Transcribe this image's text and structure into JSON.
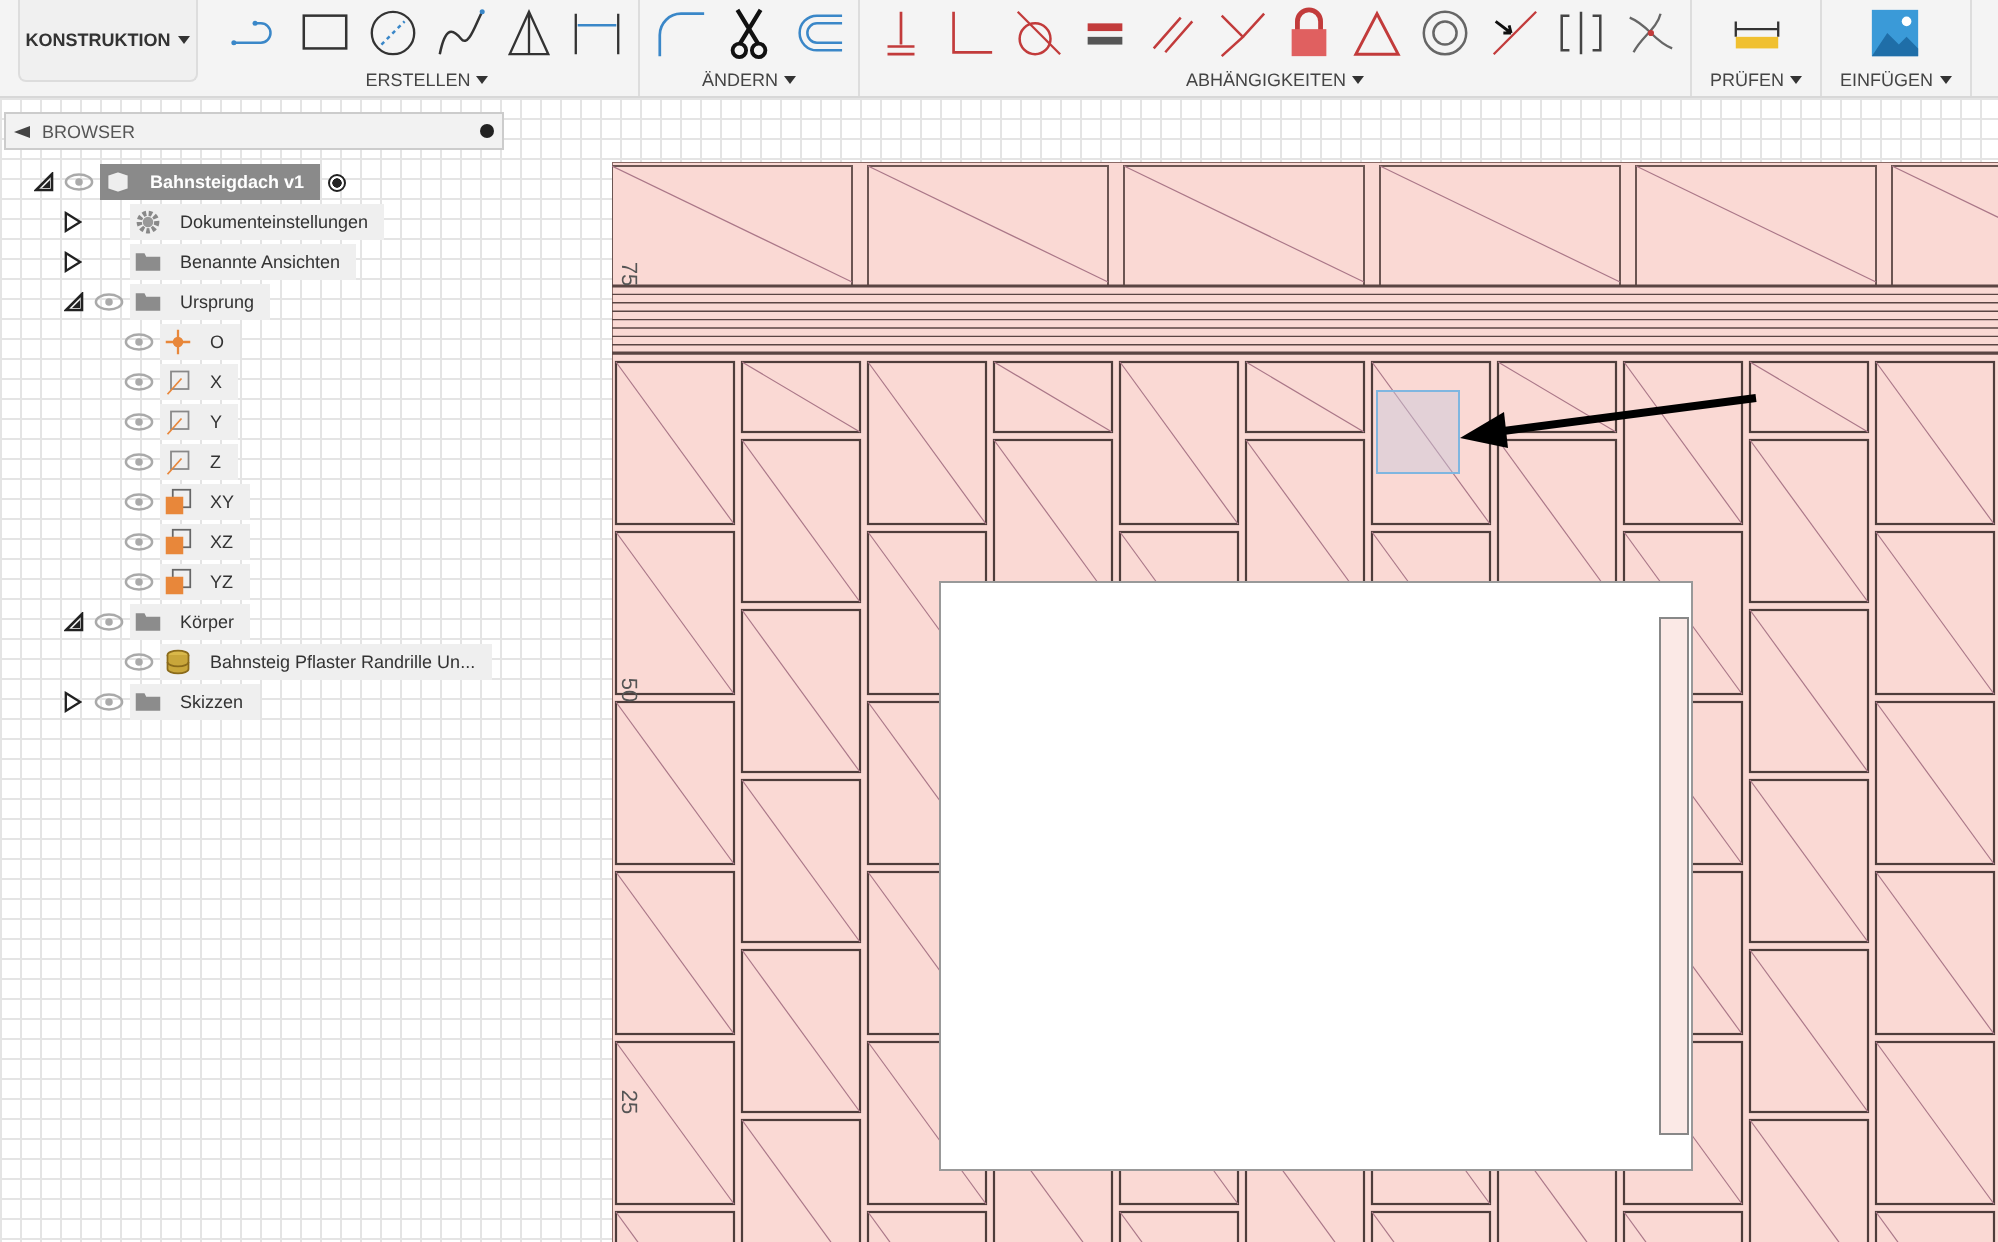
{
  "toolbar": {
    "workspace": "KONSTRUKTION",
    "groups": [
      {
        "label": "ERSTELLEN"
      },
      {
        "label": "ÄNDERN"
      },
      {
        "label": "ABHÄNGIGKEITEN"
      },
      {
        "label": "PRÜFEN"
      },
      {
        "label": "EINFÜGEN"
      }
    ]
  },
  "browser": {
    "title": "BROWSER",
    "items": [
      {
        "kind": "component",
        "label": "Bahnsteigdach v1",
        "eye": true,
        "expanded": true,
        "active": true,
        "selected": true,
        "children": [
          {
            "kind": "gear",
            "label": "Dokumenteinstellungen",
            "eye": false,
            "expanded": false,
            "selected": false
          },
          {
            "kind": "folder",
            "label": "Benannte Ansichten",
            "eye": false,
            "expanded": false,
            "selected": false
          },
          {
            "kind": "folder",
            "label": "Ursprung",
            "eye": true,
            "expanded": true,
            "selected": false,
            "children": [
              {
                "kind": "point",
                "label": "O",
                "eye": true,
                "selected": false
              },
              {
                "kind": "axis",
                "label": "X",
                "eye": true,
                "selected": false
              },
              {
                "kind": "axis",
                "label": "Y",
                "eye": true,
                "selected": false
              },
              {
                "kind": "axis",
                "label": "Z",
                "eye": true,
                "selected": false
              },
              {
                "kind": "plane",
                "label": "XY",
                "eye": true,
                "selected": false
              },
              {
                "kind": "plane",
                "label": "XZ",
                "eye": true,
                "selected": false
              },
              {
                "kind": "plane",
                "label": "YZ",
                "eye": true,
                "selected": false
              }
            ]
          },
          {
            "kind": "folder",
            "label": "Körper",
            "eye": true,
            "expanded": true,
            "selected": false,
            "children": [
              {
                "kind": "body",
                "label": "Bahnsteig Pflaster Randrille Un...",
                "eye": true,
                "selected": false
              }
            ]
          },
          {
            "kind": "folder",
            "label": "Skizzen",
            "eye": true,
            "expanded": false,
            "selected": false
          }
        ]
      }
    ]
  },
  "canvas": {
    "ruler_labels": [
      "75",
      "50",
      "25"
    ]
  }
}
